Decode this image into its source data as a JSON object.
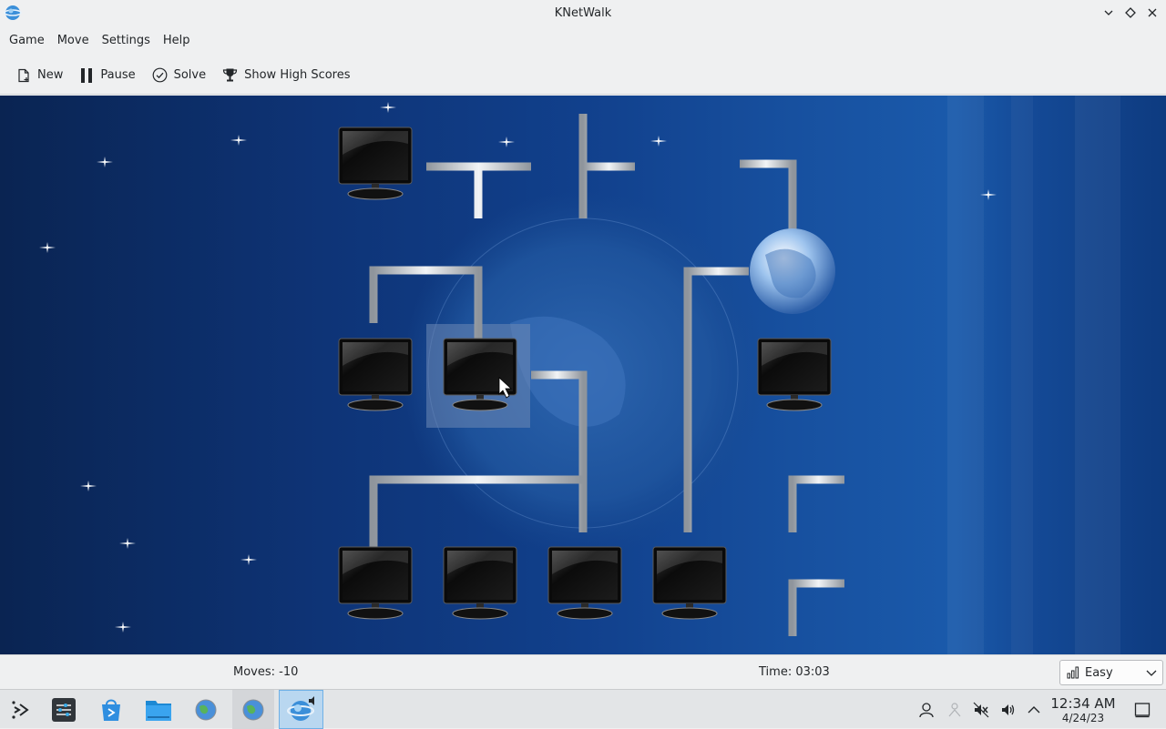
{
  "window": {
    "title": "KNetWalk",
    "app_icon": "knetwalk-icon",
    "controls": [
      "minimize-icon",
      "maximize-icon",
      "close-icon"
    ]
  },
  "menu": {
    "items": [
      "Game",
      "Move",
      "Settings",
      "Help"
    ]
  },
  "toolbar": {
    "new_label": "New",
    "pause_label": "Pause",
    "solve_label": "Solve",
    "highscores_label": "Show High Scores"
  },
  "status": {
    "moves": "Moves: -10",
    "time": "Time: 03:03",
    "difficulty": "Easy"
  },
  "taskbar": {
    "apps": [
      "application-launcher-icon",
      "system-settings-icon",
      "discover-icon",
      "dolphin-file-manager-icon",
      "network-globe-icon",
      "network-globe-icon",
      "knetwalk-icon"
    ],
    "tray": [
      "user-icon",
      "network-icon",
      "muted-microphone-icon",
      "volume-icon",
      "show-hidden-icons-chevron"
    ],
    "clock_time": "12:34 AM",
    "clock_date": "4/24/23"
  },
  "colors": {
    "board_blue": "#0e3477",
    "cable": "#c9cdd2",
    "highlight": "#6e89b5"
  }
}
